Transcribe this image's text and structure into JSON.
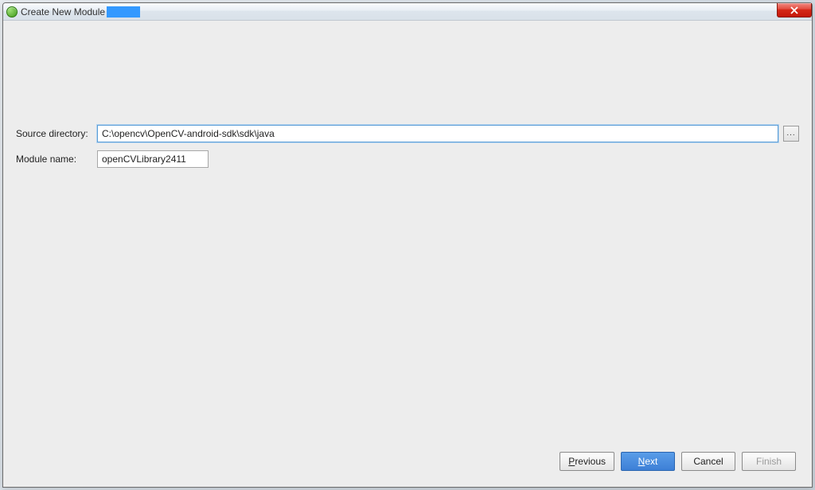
{
  "window": {
    "title": "Create New Module"
  },
  "form": {
    "source_label": "Source directory:",
    "source_value": "C:\\opencv\\OpenCV-android-sdk\\sdk\\java",
    "browse_label": "...",
    "module_label": "Module name:",
    "module_value": "openCVLibrary2411"
  },
  "buttons": {
    "previous": "Previous",
    "previous_mn": "P",
    "previous_rest": "revious",
    "next": "Next",
    "next_mn": "N",
    "next_rest": "ext",
    "cancel": "Cancel",
    "finish": "Finish"
  }
}
